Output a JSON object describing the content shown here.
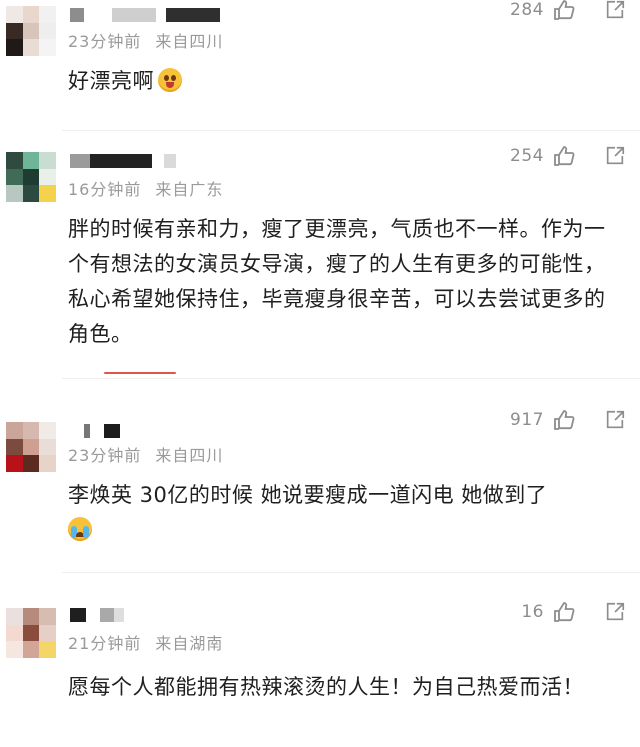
{
  "comments": [
    {
      "time": "23分钟前",
      "location": "来自四川",
      "likes": "284",
      "text": "好漂亮啊",
      "avatar_colors": [
        "#f0e8e4",
        "#e9d7cd",
        "#f1f1f1",
        "#3a2a25",
        "#d7c4bb",
        "#eeeeee",
        "#1f1a18",
        "#e8dcd4",
        "#f4f4f4"
      ]
    },
    {
      "time": "16分钟前",
      "location": "来自广东",
      "likes": "254",
      "text": "胖的时候有亲和力，瘦了更漂亮，气质也不一样。作为一个有想法的女演员女导演，瘦了的人生有更多的可能性，私心希望她保持住，毕竟瘦身很辛苦，可以去尝试更多的角色。",
      "avatar_colors": [
        "#2f4a3e",
        "#6fb59a",
        "#c9ddd3",
        "#3f6b57",
        "#1f3c33",
        "#e9efe9",
        "#b9c7c1",
        "#2c4a40",
        "#f5d24b"
      ]
    },
    {
      "time": "23分钟前",
      "location": "来自四川",
      "likes": "917",
      "text": "李焕英 30亿的时候 她说要瘦成一道闪电 她做到了",
      "avatar_colors": [
        "#caa59a",
        "#d6b8ae",
        "#f1ebe8",
        "#7b4b3f",
        "#cfa091",
        "#e9ddd8",
        "#b7121a",
        "#5b2a20",
        "#e8d3c8"
      ]
    },
    {
      "time": "21分钟前",
      "location": "来自湖南",
      "likes": "16",
      "text": "愿每个人都能拥有热辣滚烫的人生！为自己热爱而活！",
      "avatar_colors": [
        "#eae1de",
        "#b68b7d",
        "#d7bcb1",
        "#f3d9cf",
        "#8a4d3d",
        "#e6cfc6",
        "#f6e6e0",
        "#d2a697",
        "#f3d667"
      ]
    }
  ],
  "icons": {
    "like": "thumbs-up-icon",
    "share": "share-icon"
  },
  "colors": {
    "meta_text": "#9a9a9a",
    "body_text": "#1f1f1f",
    "divider": "#eeeeee",
    "accent_red": "#e0564c"
  }
}
